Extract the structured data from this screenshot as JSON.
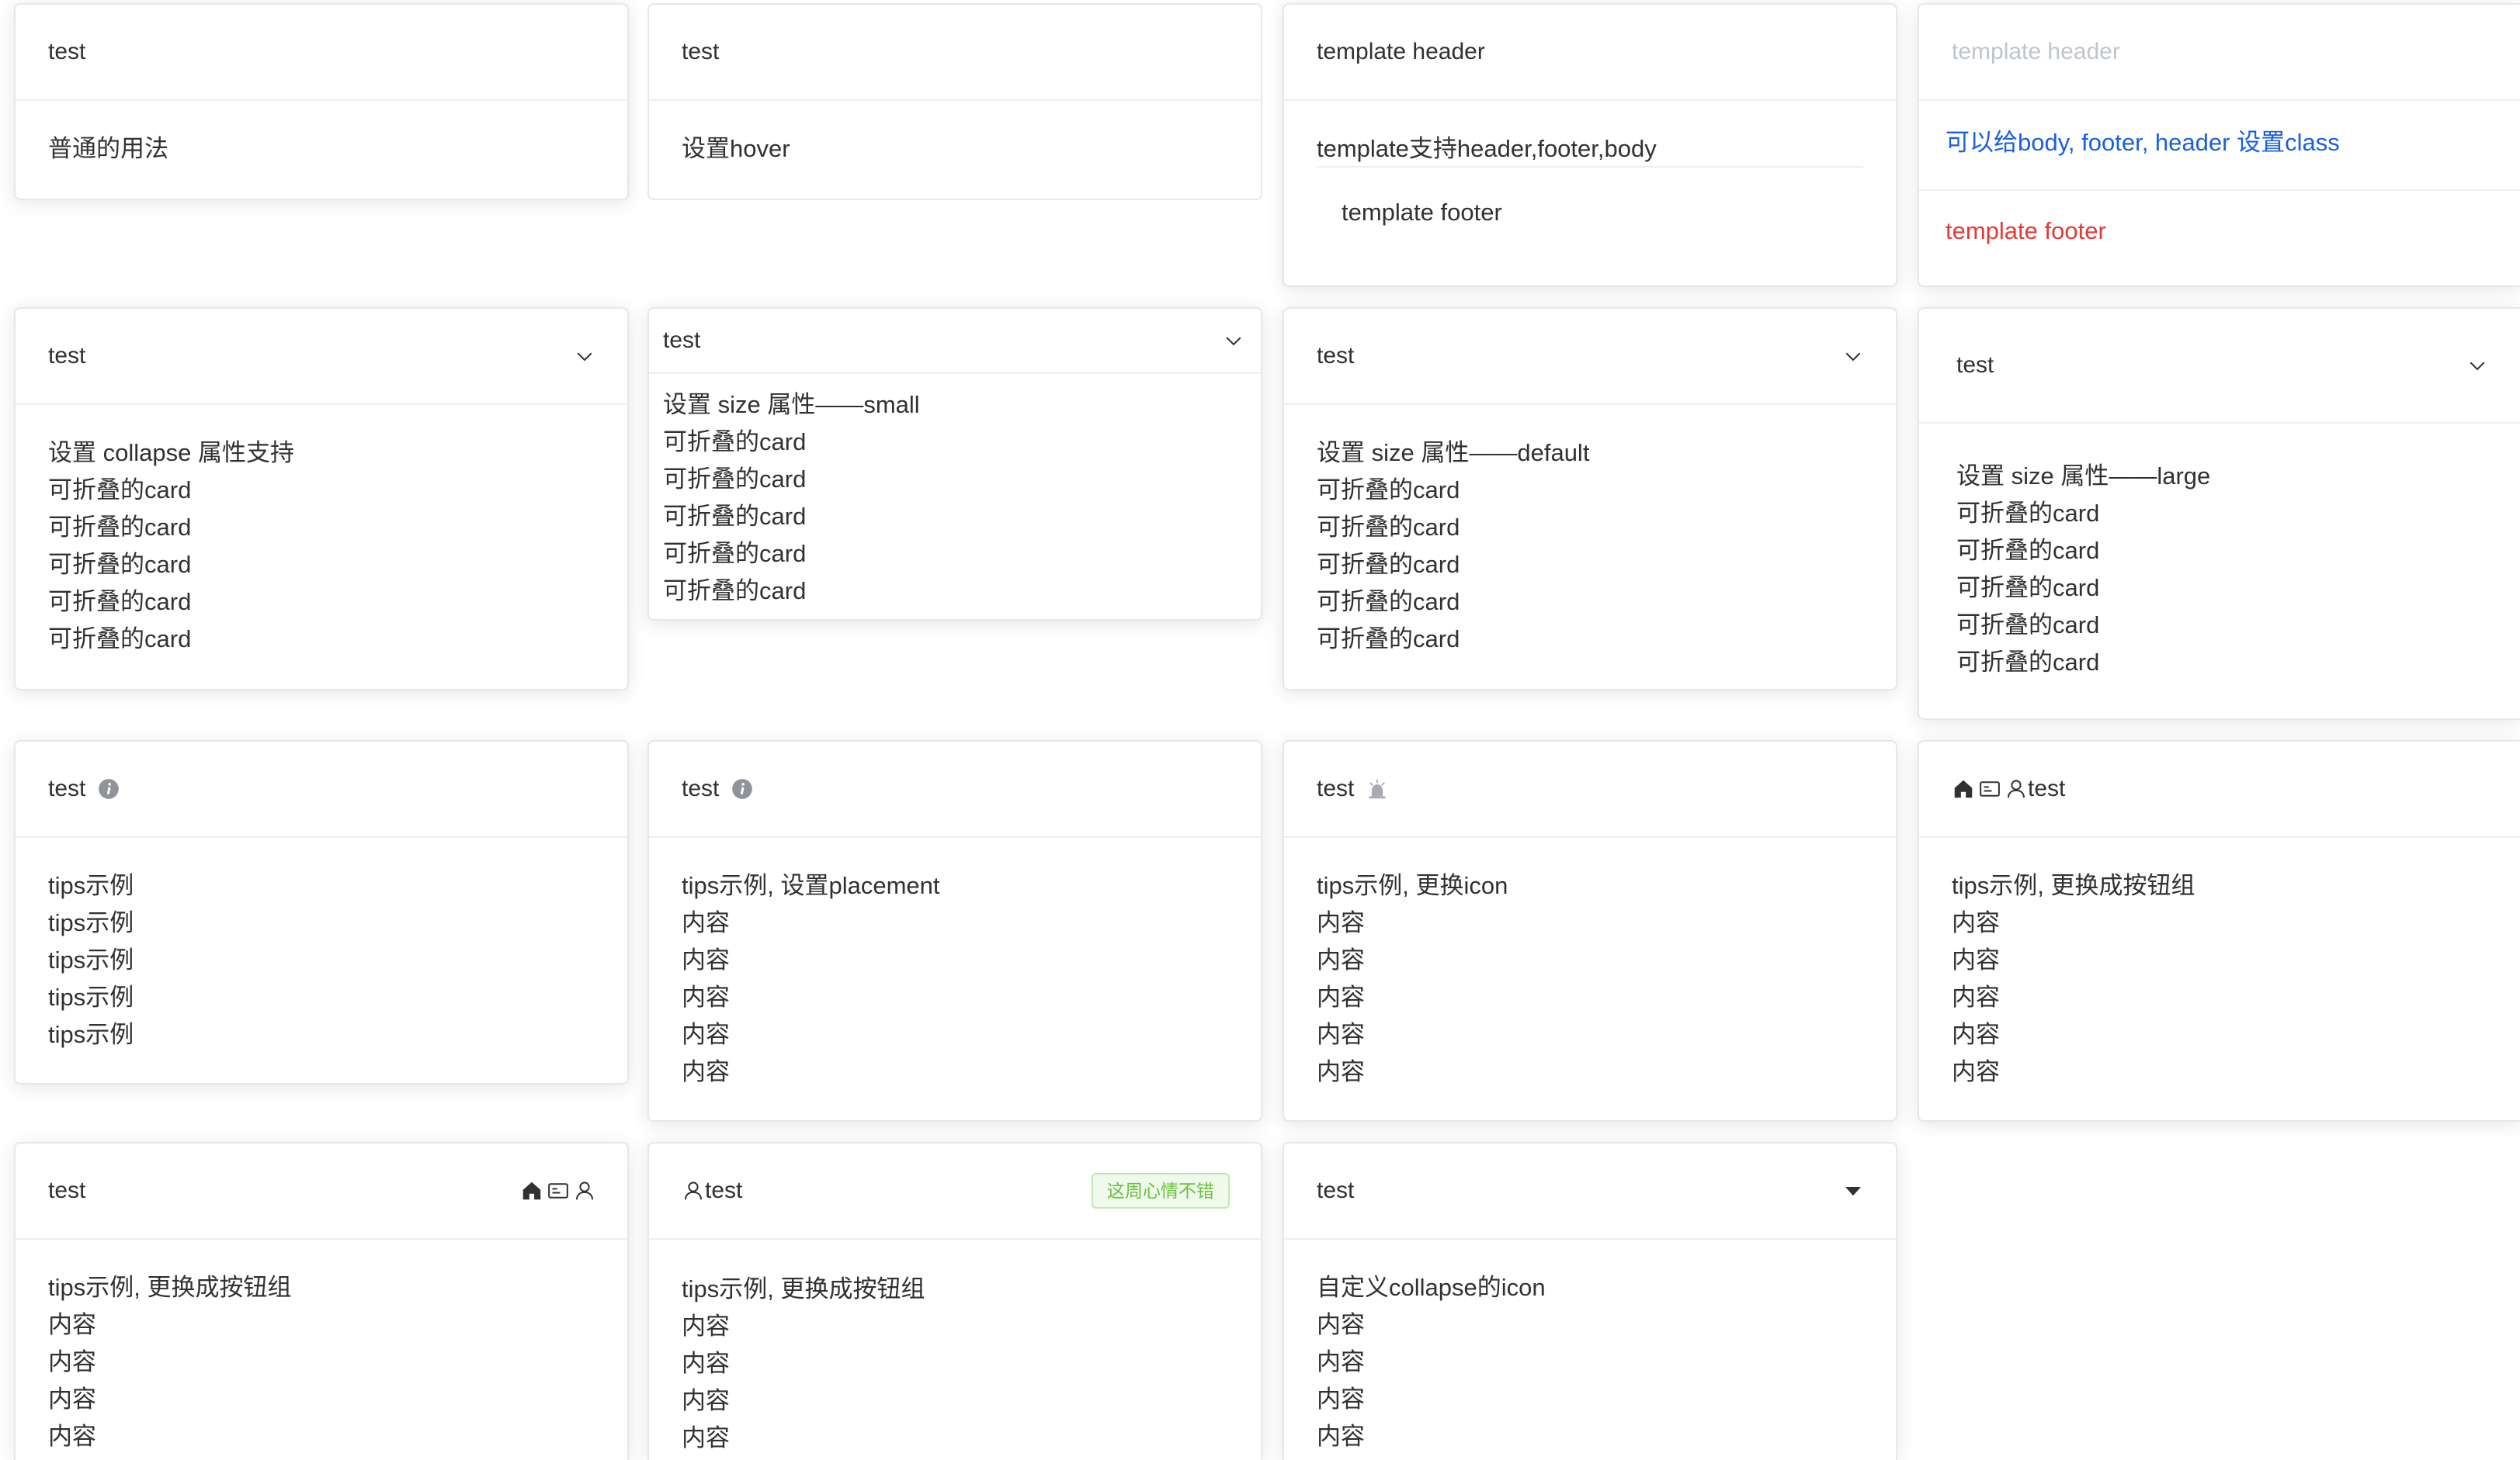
{
  "colors": {
    "primary": "#1a5fe0",
    "danger": "#e53935",
    "muted": "#c0c4cc",
    "success": "#67c23a"
  },
  "row1": {
    "c1": {
      "header": "test",
      "body": "普通的用法"
    },
    "c2": {
      "header": "test",
      "body": "设置hover"
    },
    "c3": {
      "header": "template header",
      "body": "template支持header,footer,body",
      "footer": "template footer"
    },
    "c4": {
      "header": "template header",
      "body": "可以给body, footer, header 设置class",
      "footer": "template footer"
    }
  },
  "row2": {
    "c1": {
      "header": "test",
      "lines": [
        "设置 collapse 属性支持",
        "可折叠的card",
        "可折叠的card",
        "可折叠的card",
        "可折叠的card",
        "可折叠的card"
      ],
      "collapse_icon": "chevron-down-icon"
    },
    "c2": {
      "header": "test",
      "lines": [
        "设置 size 属性——small",
        "可折叠的card",
        "可折叠的card",
        "可折叠的card",
        "可折叠的card",
        "可折叠的card"
      ],
      "collapse_icon": "chevron-down-icon"
    },
    "c3": {
      "header": "test",
      "lines": [
        "设置 size 属性——default",
        "可折叠的card",
        "可折叠的card",
        "可折叠的card",
        "可折叠的card",
        "可折叠的card"
      ],
      "collapse_icon": "chevron-down-icon"
    },
    "c4": {
      "header": "test",
      "lines": [
        "设置 size 属性——large",
        "可折叠的card",
        "可折叠的card",
        "可折叠的card",
        "可折叠的card",
        "可折叠的card"
      ],
      "collapse_icon": "chevron-down-icon"
    }
  },
  "row3": {
    "c1": {
      "header": "test",
      "icon": "info-icon",
      "lines": [
        "tips示例",
        "tips示例",
        "tips示例",
        "tips示例",
        "tips示例"
      ]
    },
    "c2": {
      "header": "test",
      "icon": "info-icon",
      "lines": [
        "tips示例, 设置placement",
        "内容",
        "内容",
        "内容",
        "内容",
        "内容"
      ]
    },
    "c3": {
      "header": "test",
      "icon": "alarm-icon",
      "lines": [
        "tips示例, 更换icon",
        "内容",
        "内容",
        "内容",
        "内容",
        "内容"
      ]
    },
    "c4": {
      "header": "test",
      "icons": [
        "home-icon",
        "id-card-icon",
        "user-icon"
      ],
      "lines": [
        "tips示例, 更换成按钮组",
        "内容",
        "内容",
        "内容",
        "内容",
        "内容"
      ]
    }
  },
  "row4": {
    "c1": {
      "header": "test",
      "icons": [
        "home-icon",
        "id-card-icon",
        "user-icon"
      ],
      "lines": [
        "tips示例, 更换成按钮组",
        "内容",
        "内容",
        "内容",
        "内容"
      ]
    },
    "c2": {
      "header": "test",
      "icon": "user-icon",
      "tag": "这周心情不错",
      "lines": [
        "tips示例, 更换成按钮组",
        "内容",
        "内容",
        "内容",
        "内容"
      ]
    },
    "c3": {
      "header": "test",
      "collapse_icon": "caret-down-icon",
      "lines": [
        "自定义collapse的icon",
        "内容",
        "内容",
        "内容",
        "内容"
      ]
    }
  }
}
